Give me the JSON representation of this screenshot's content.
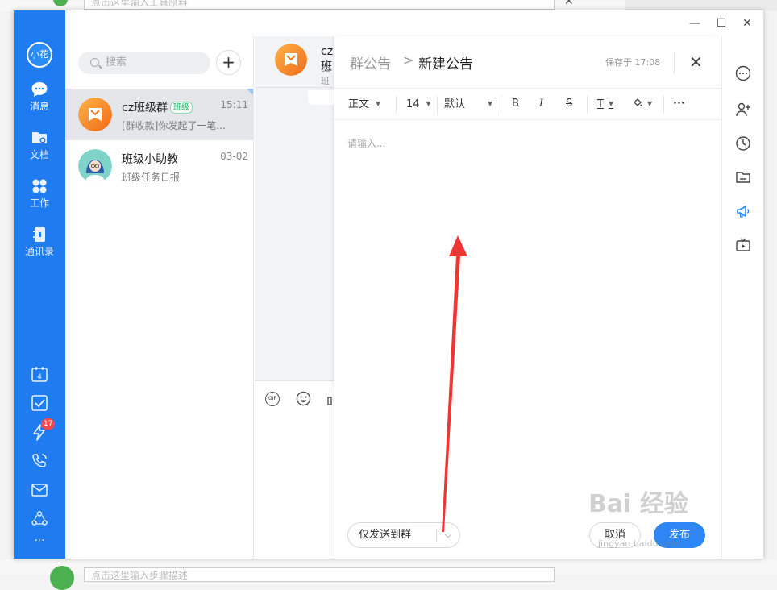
{
  "background": {
    "top_input_placeholder": "点击这里输入工具原料",
    "bottom_input_placeholder": "点击这里输入步骤描述"
  },
  "nav": {
    "avatar": "小花",
    "items": [
      {
        "label": "消息",
        "icon": "chat-bubble-icon"
      },
      {
        "label": "文档",
        "icon": "folder-icon"
      },
      {
        "label": "工作",
        "icon": "apps-grid-icon"
      },
      {
        "label": "通讯录",
        "icon": "contacts-book-icon"
      }
    ],
    "bottom_icons": [
      "calendar-icon",
      "todo-check-icon",
      "lightning-icon",
      "phone-callback-icon",
      "mail-icon",
      "share-circles-icon",
      "more-dots-icon"
    ],
    "calendar_day": "4",
    "badge_count": "17",
    "more": "···"
  },
  "list": {
    "search_placeholder": "搜索",
    "add_label": "+",
    "conversations": [
      {
        "name": "cz班级群",
        "tag": "班级",
        "time": "15:11",
        "preview": "[群收款]你发起了一笔...",
        "selected": true
      },
      {
        "name": "班级小助教",
        "tag": "",
        "time": "03-02",
        "preview": "班级任务日报",
        "selected": false
      }
    ]
  },
  "chat": {
    "group_name": "cz班",
    "group_sub": "cz班",
    "tool_gif": "GIF"
  },
  "announcement": {
    "breadcrumb_parent": "群公告",
    "breadcrumb_sep": ">",
    "breadcrumb_current": "新建公告",
    "saved_status": "保存于 17:08",
    "close": "✕",
    "toolbar": {
      "style": "正文",
      "size": "14",
      "font": "默认",
      "bold": "B",
      "italic": "I",
      "strike": "S",
      "text_color": "T",
      "more": "···"
    },
    "placeholder": "请输入...",
    "send_target": "仅发送到群",
    "cancel": "取消",
    "publish": "发布"
  },
  "right_bar": {
    "icons": [
      "more-circle-icon",
      "add-member-icon",
      "history-clock-icon",
      "folder-icon",
      "megaphone-icon",
      "tv-icon"
    ]
  },
  "window_controls": {
    "minimize": "—",
    "maximize": "☐",
    "close": "✕"
  },
  "watermark": {
    "text": "Bai 经验",
    "url": "jingyan.baidu.com"
  },
  "colors": {
    "nav_blue": "#1e7cf0",
    "accent": "#2e86f4",
    "arrow_red": "#f03535"
  }
}
